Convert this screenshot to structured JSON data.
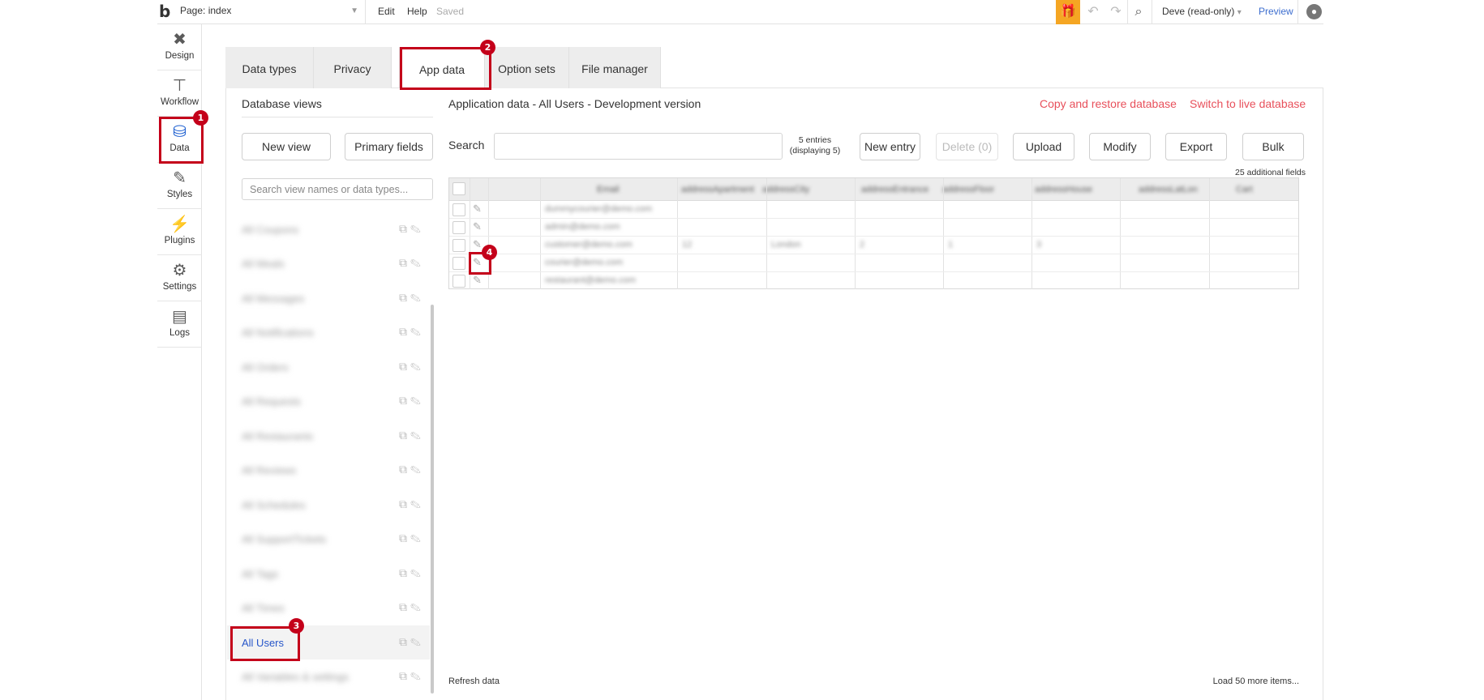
{
  "topbar": {
    "page_label": "Page: index",
    "edit": "Edit",
    "help": "Help",
    "saved": "Saved",
    "user": "Deve (read-only)",
    "preview": "Preview"
  },
  "rail": [
    {
      "label": "Design",
      "icon": "design-icon"
    },
    {
      "label": "Workflow",
      "icon": "workflow-icon"
    },
    {
      "label": "Data",
      "icon": "database-icon"
    },
    {
      "label": "Styles",
      "icon": "brush-icon"
    },
    {
      "label": "Plugins",
      "icon": "plug-icon"
    },
    {
      "label": "Settings",
      "icon": "gear-icon"
    },
    {
      "label": "Logs",
      "icon": "document-icon"
    }
  ],
  "tabs": [
    "Data types",
    "Privacy",
    "App data",
    "Option sets",
    "File manager"
  ],
  "active_tab": "App data",
  "database_views": {
    "title": "Database views",
    "new_view": "New view",
    "primary_fields": "Primary fields",
    "search_placeholder": "Search view names or data types...",
    "items": [
      "All Coupons",
      "All Meals",
      "All Messages",
      "All Notifications",
      "All Orders",
      "All Requests",
      "All Restaurants",
      "All Reviews",
      "All Schedules",
      "All SupportTickets",
      "All Tags",
      "All Times",
      "All Users",
      "All Variables & settings"
    ],
    "selected": "All Users"
  },
  "app_data": {
    "title": "Application data - All Users - Development version",
    "copy_restore": "Copy and restore database",
    "switch_live": "Switch to live database",
    "search_label": "Search",
    "entries_line1": "5 entries",
    "entries_line2": "(displaying 5)",
    "buttons": {
      "new_entry": "New entry",
      "delete": "Delete (0)",
      "upload": "Upload",
      "modify": "Modify",
      "export": "Export",
      "bulk": "Bulk"
    },
    "additional_fields": "25 additional fields",
    "columns": [
      "Email",
      "addressApartment",
      "addressCity",
      "addressEntrance",
      "addressFloor",
      "addressHouse",
      "addressLatLon",
      "Cart"
    ],
    "rows": [
      [
        "dummycourier@demo.com",
        "",
        "",
        "",
        "",
        "",
        "",
        ""
      ],
      [
        "admin@demo.com",
        "",
        "",
        "",
        "",
        "",
        "",
        ""
      ],
      [
        "customer@demo.com",
        "12",
        "London",
        "2",
        "1",
        "3",
        "",
        ""
      ],
      [
        "courier@demo.com",
        "",
        "",
        "",
        "",
        "",
        "",
        ""
      ],
      [
        "restaurant@demo.com",
        "",
        "",
        "",
        "",
        "",
        "",
        ""
      ]
    ],
    "refresh": "Refresh data",
    "load_more": "Load 50 more items..."
  },
  "annotations": [
    "1",
    "2",
    "3",
    "4"
  ],
  "colors": {
    "annotation": "#c4001a",
    "link_red": "#e8505b",
    "link_blue": "#3d6ecf",
    "gift": "#f5a623"
  }
}
